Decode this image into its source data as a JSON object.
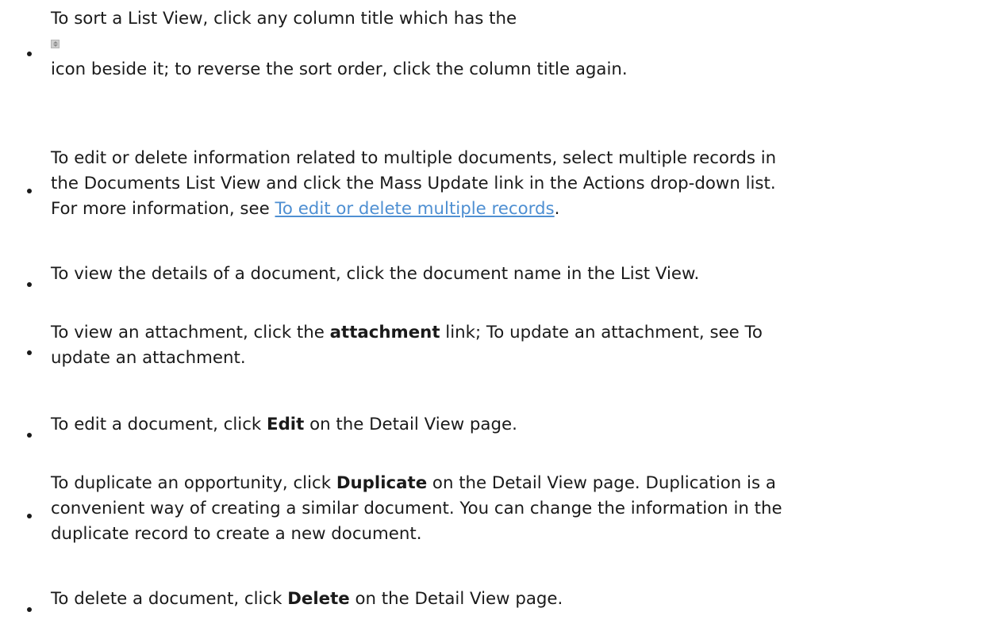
{
  "items": [
    {
      "line1": "To sort a List View, click any column title which has the",
      "icon": "sort-icon",
      "line2": "icon beside it; to reverse the sort order, click the column title again."
    },
    {
      "line1": "To edit or delete information related to multiple documents, select multiple records in",
      "line2": "the Documents List View and click the Mass Update link in the Actions drop-down list.",
      "line3_pre": "For more information, see ",
      "line3_link": "To edit or delete multiple records",
      "line3_post": "."
    },
    {
      "line1": "To view the details of a document, click the document name in the List View."
    },
    {
      "line1_pre": "To view an attachment, click the ",
      "line1_bold": "attachment",
      "line1_post": " link; To update an attachment, see To",
      "line2": "update an attachment."
    },
    {
      "pre": "To edit a document, click ",
      "bold": "Edit",
      "post": " on the Detail View page."
    },
    {
      "line1_pre": "To duplicate an opportunity, click ",
      "line1_bold": "Duplicate",
      "line1_post": " on the Detail View page. Duplication is a",
      "line2": "convenient way of creating a similar document. You can change the information in the",
      "line3": "duplicate record to create a new document."
    },
    {
      "pre": "To delete a document, click ",
      "bold": "Delete",
      "post": " on the Detail View page."
    }
  ]
}
